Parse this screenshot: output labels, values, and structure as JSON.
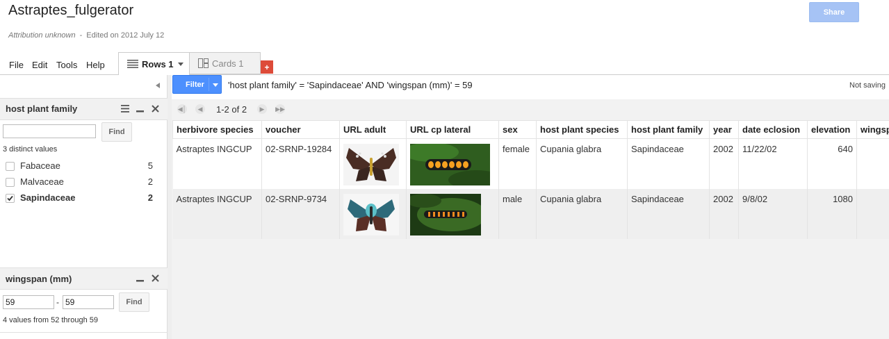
{
  "document": {
    "title": "Astraptes_fulgerator",
    "attribution": "Attribution unknown",
    "separator": "-",
    "edited": "Edited on 2012 July 12"
  },
  "header": {
    "share_label": "Share"
  },
  "menu": {
    "file": "File",
    "edit": "Edit",
    "tools": "Tools",
    "help": "Help"
  },
  "tabs": {
    "rows": "Rows 1",
    "cards": "Cards 1",
    "add": "+"
  },
  "filter_bar": {
    "button_label": "Filter",
    "expression": "'host plant family' = 'Sapindaceae' AND 'wingspan (mm)' = 59",
    "save_status": "Not saving"
  },
  "facet_host": {
    "title": "host plant family",
    "search_value": "",
    "find_label": "Find",
    "distinct": "3 distinct values",
    "values": [
      {
        "label": "Fabaceae",
        "count": "5",
        "checked": false
      },
      {
        "label": "Malvaceae",
        "count": "2",
        "checked": false
      },
      {
        "label": "Sapindaceae",
        "count": "2",
        "checked": true
      }
    ]
  },
  "facet_wingspan": {
    "title": "wingspan (mm)",
    "min": "59",
    "dash": "-",
    "max": "59",
    "find_label": "Find",
    "summary": "4 values from 52 through 59"
  },
  "pager": {
    "range": "1-2 of 2"
  },
  "table": {
    "columns": [
      "herbivore species",
      "voucher",
      "URL adult",
      "URL cp lateral",
      "sex",
      "host plant species",
      "host plant family",
      "year",
      "date eclosion",
      "elevation",
      "wingsp"
    ],
    "rows": [
      {
        "species": "Astraptes INGCUP",
        "voucher": "02-SRNP-19284",
        "sex": "female",
        "host_species": "Cupania glabra",
        "host_family": "Sapindaceae",
        "year": "2002",
        "date": "11/22/02",
        "elevation": "640"
      },
      {
        "species": "Astraptes INGCUP",
        "voucher": "02-SRNP-9734",
        "sex": "male",
        "host_species": "Cupania glabra",
        "host_family": "Sapindaceae",
        "year": "2002",
        "date": "9/8/02",
        "elevation": "1080"
      }
    ]
  },
  "colors": {
    "filter_blue": "#4d90fe",
    "share_blue": "#a6c3f5",
    "add_red": "#dd4b39"
  },
  "icons": [
    "list-icon",
    "cards-icon",
    "menu-icon",
    "minimize-icon",
    "close-icon",
    "first-page-icon",
    "prev-page-icon",
    "next-page-icon",
    "last-page-icon",
    "collapse-arrow-icon",
    "checkmark-icon",
    "dropdown-arrow-icon"
  ]
}
